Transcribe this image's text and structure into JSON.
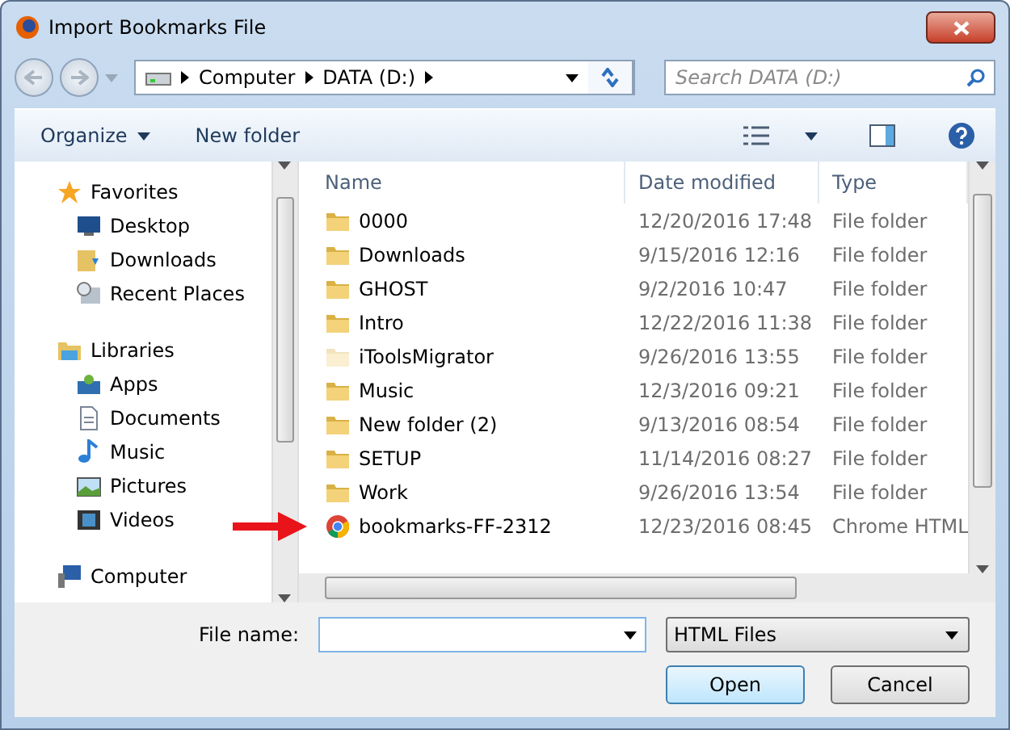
{
  "window": {
    "title": "Import Bookmarks File"
  },
  "address": {
    "crumbs": [
      "Computer",
      "DATA (D:)"
    ],
    "search_placeholder": "Search DATA (D:)"
  },
  "toolbar": {
    "organize": "Organize",
    "new_folder": "New folder"
  },
  "sidebar": {
    "groups": [
      {
        "label": "Favorites",
        "kind": "favorites",
        "children": [
          {
            "label": "Desktop",
            "kind": "desktop"
          },
          {
            "label": "Downloads",
            "kind": "downloads"
          },
          {
            "label": "Recent Places",
            "kind": "recent"
          }
        ]
      },
      {
        "label": "Libraries",
        "kind": "libraries",
        "children": [
          {
            "label": "Apps",
            "kind": "apps"
          },
          {
            "label": "Documents",
            "kind": "documents"
          },
          {
            "label": "Music",
            "kind": "music"
          },
          {
            "label": "Pictures",
            "kind": "pictures"
          },
          {
            "label": "Videos",
            "kind": "videos"
          }
        ]
      },
      {
        "label": "Computer",
        "kind": "computer"
      }
    ]
  },
  "table": {
    "columns": [
      "Name",
      "Date modified",
      "Type"
    ],
    "rows": [
      {
        "name": "0000",
        "date": "12/20/2016 17:48",
        "type": "File folder",
        "kind": "folder",
        "hidden": false
      },
      {
        "name": "Downloads",
        "date": "9/15/2016 12:16",
        "type": "File folder",
        "kind": "folder",
        "hidden": false
      },
      {
        "name": "GHOST",
        "date": "9/2/2016 10:47",
        "type": "File folder",
        "kind": "folder",
        "hidden": false
      },
      {
        "name": "Intro",
        "date": "12/22/2016 11:38",
        "type": "File folder",
        "kind": "folder",
        "hidden": false
      },
      {
        "name": "iToolsMigrator",
        "date": "9/26/2016 13:55",
        "type": "File folder",
        "kind": "folder",
        "hidden": true
      },
      {
        "name": "Music",
        "date": "12/3/2016 09:21",
        "type": "File folder",
        "kind": "folder",
        "hidden": false
      },
      {
        "name": "New folder (2)",
        "date": "9/13/2016 08:54",
        "type": "File folder",
        "kind": "folder",
        "hidden": false
      },
      {
        "name": "SETUP",
        "date": "11/14/2016 08:27",
        "type": "File folder",
        "kind": "folder",
        "hidden": false
      },
      {
        "name": "Work",
        "date": "9/26/2016 13:54",
        "type": "File folder",
        "kind": "folder",
        "hidden": false
      },
      {
        "name": "bookmarks-FF-2312",
        "date": "12/23/2016 08:45",
        "type": "Chrome HTML",
        "kind": "html",
        "hidden": false
      }
    ]
  },
  "footer": {
    "file_name_label": "File name:",
    "file_type": "HTML Files",
    "buttons": [
      "Open",
      "Cancel"
    ]
  }
}
